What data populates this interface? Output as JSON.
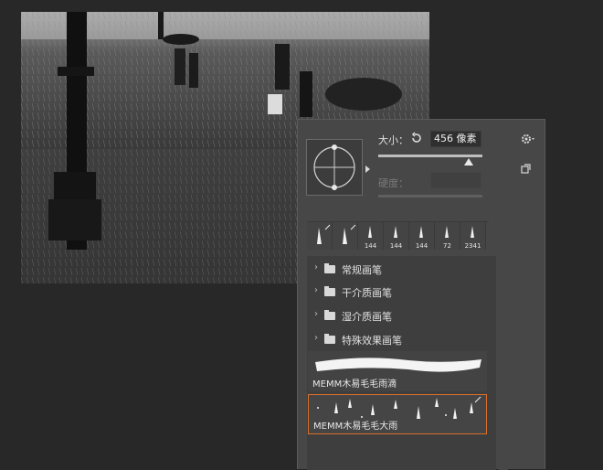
{
  "panel": {
    "size_label": "大小：",
    "size_value": "456 像素",
    "hardness_label": "硬度："
  },
  "recent_brushes": [
    "",
    "",
    "144",
    "144",
    "144",
    "72",
    "2341"
  ],
  "folders": [
    {
      "label": "常规画笔"
    },
    {
      "label": "干介质画笔"
    },
    {
      "label": "湿介质画笔"
    },
    {
      "label": "特殊效果画笔"
    }
  ],
  "presets": [
    {
      "label": "MEMM木易毛毛雨滴"
    },
    {
      "label": "MEMM木易毛毛大雨"
    }
  ],
  "colors": {
    "accent": "#d96f2b",
    "panel_bg": "#474747",
    "app_bg": "#282828"
  }
}
